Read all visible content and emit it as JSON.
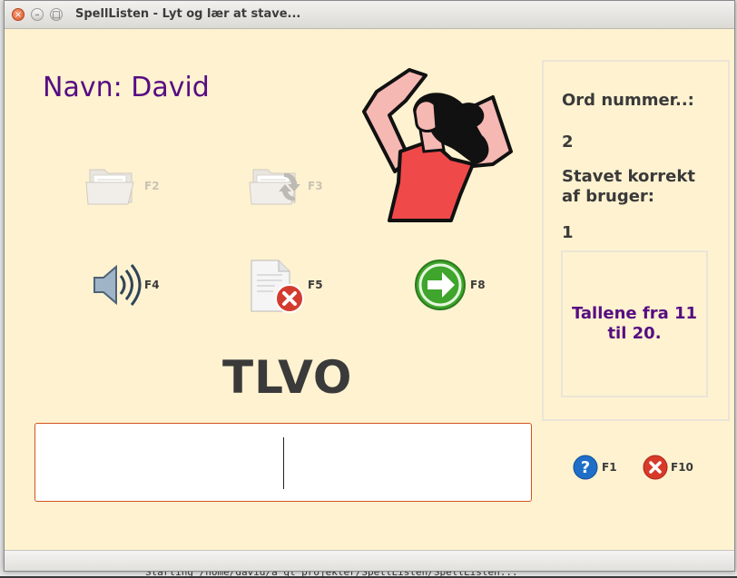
{
  "window": {
    "title": "SpellListen - Lyt og lær at stave..."
  },
  "titlebar_buttons": {
    "close": "×",
    "minimize": "–",
    "maximize": "□"
  },
  "background_terminal": {
    "bottom_text": "Starting /home/david/a qt projekter/SpellListen/SpellListen..."
  },
  "user": {
    "name_label": "Navn: David"
  },
  "toolbar": {
    "open_key": "F2",
    "reload_key": "F3",
    "play_key": "F4",
    "clear_key": "F5",
    "next_key": "F8",
    "help_key": "F1",
    "exit_key": "F10"
  },
  "word_display": "TLVO",
  "entry": {
    "value": ""
  },
  "panel": {
    "word_number_label": "Ord nummer..:",
    "word_number_value": "2",
    "correct_label_line1": "Stavet korrekt",
    "correct_label_line2": "af bruger:",
    "correct_value": "1",
    "info_line1": "Tallene fra 11",
    "info_line2": "til 20."
  },
  "colors": {
    "window_bg": "#fff2d0",
    "name_purple": "#560d82",
    "entry_border": "#d2541e",
    "next_green": "#3fa52c",
    "help_blue": "#1f6fc8",
    "exit_red": "#d83a2a"
  }
}
